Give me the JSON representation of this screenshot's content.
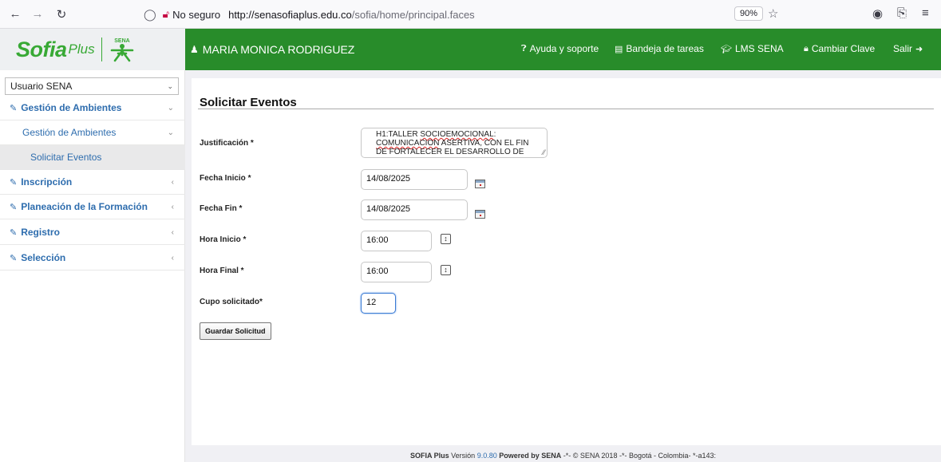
{
  "browser": {
    "not_secure_label": "No seguro",
    "url_host": "http://senasofiaplus.edu.co",
    "url_path": "/sofia/home/principal.faces",
    "zoom": "90%"
  },
  "header": {
    "logo_sofia": "Sofia",
    "logo_plus": "Plus",
    "logo_sena": "SENA",
    "user_name": "MARIA MONICA RODRIGUEZ",
    "nav": {
      "help": "Ayuda y soporte",
      "tasks": "Bandeja de tareas",
      "lms": "LMS SENA",
      "change_password": "Cambiar Clave",
      "logout": "Salir"
    },
    "colors": {
      "brand_green": "#288c2a",
      "logo_green": "#38a935"
    }
  },
  "sidebar": {
    "role": "Usuario SENA",
    "items": [
      {
        "label": "Gestión de Ambientes"
      },
      {
        "label": "Gestión de Ambientes"
      },
      {
        "label": "Solicitar Eventos"
      },
      {
        "label": "Inscripción"
      },
      {
        "label": "Planeación de la Formación"
      },
      {
        "label": "Registro"
      },
      {
        "label": "Selección"
      }
    ]
  },
  "form": {
    "title": "Solicitar Eventos",
    "justificacion_label": "Justificación *",
    "justificacion_value_1": "H1:TALLER ",
    "justificacion_spell_1": "SOCIOEMOCIONAL",
    "justificacion_value_2": ":",
    "justificacion_spell_2": "COMUNICACION",
    "justificacion_value_3": " ASERTIVA, CON EL FIN DE FORTALECER EL DESARROLLO DE",
    "fecha_inicio_label": "Fecha Inicio *",
    "fecha_inicio_value": "14/08/2025",
    "fecha_fin_label": "Fecha Fin *",
    "fecha_fin_value": "14/08/2025",
    "hora_inicio_label": "Hora Inicio *",
    "hora_inicio_value": "16:00",
    "hora_final_label": "Hora Final *",
    "hora_final_value": "16:00",
    "cupo_label": "Cupo solicitado*",
    "cupo_value": "12",
    "submit_label": "Guardar Solicitud"
  },
  "footer": {
    "brand": "SOFIA Plus",
    "version_prefix": " Versión ",
    "version": "9.0.80",
    "powered": " Powered by ",
    "sena": "SENA",
    "rest": " -*- © SENA 2018 -*- Bogotá - Colombia- *-a143:"
  }
}
